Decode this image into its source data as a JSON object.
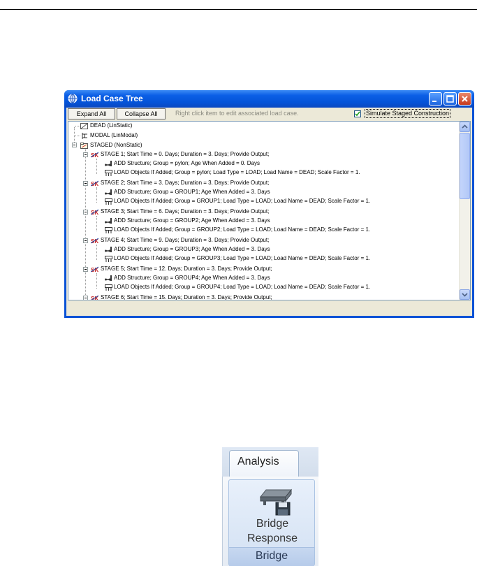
{
  "window": {
    "title": "Load Case Tree",
    "toolbar": {
      "expand_all": "Expand All",
      "collapse_all": "Collapse All",
      "hint": "Right click item to edit associated load case.",
      "simulate_label": "Simulate Staged Construction",
      "simulate_checked": true
    },
    "tree": {
      "dead": "DEAD   (LinStatic)",
      "modal": "MODAL   (LinModal)",
      "staged": "STAGED   (NonStatic)",
      "stages": [
        {
          "label": "STAGE 1;    Start Time = 0. Days;     Duration = 3. Days;     Provide Output;",
          "add": "ADD Structure;    Group = pylon;    Age When Added = 0. Days",
          "load": "LOAD Objects If Added;    Group = pylon;    Load Type = LOAD;    Load Name = DEAD;    Scale Factor = 1."
        },
        {
          "label": "STAGE 2;    Start Time = 3. Days;     Duration = 3. Days;     Provide Output;",
          "add": "ADD Structure;    Group = GROUP1;    Age When Added = 3. Days",
          "load": "LOAD Objects If Added;    Group = GROUP1;    Load Type = LOAD;    Load Name = DEAD;    Scale Factor = 1."
        },
        {
          "label": "STAGE 3;    Start Time = 6. Days;     Duration = 3. Days;     Provide Output;",
          "add": "ADD Structure;    Group = GROUP2;    Age When Added = 3. Days",
          "load": "LOAD Objects If Added;    Group = GROUP2;    Load Type = LOAD;    Load Name = DEAD;    Scale Factor = 1."
        },
        {
          "label": "STAGE 4;    Start Time = 9. Days;     Duration = 3. Days;     Provide Output;",
          "add": "ADD Structure;    Group = GROUP3;    Age When Added = 3. Days",
          "load": "LOAD Objects If Added;    Group = GROUP3;    Load Type = LOAD;    Load Name = DEAD;    Scale Factor = 1."
        },
        {
          "label": "STAGE 5;    Start Time = 12. Days;     Duration = 3. Days;     Provide Output;",
          "add": "ADD Structure;    Group = GROUP4;    Age When Added = 3. Days",
          "load": "LOAD Objects If Added;    Group = GROUP4;    Load Type = LOAD;    Load Name = DEAD;    Scale Factor = 1."
        },
        {
          "label": "STAGE 6;    Start Time = 15. Days;     Duration = 3. Days;     Provide Output;"
        }
      ]
    }
  },
  "ribbon": {
    "tab": "Analysis",
    "button_line1": "Bridge",
    "button_line2": "Response",
    "group": "Bridge"
  },
  "colors": {
    "titlebar": "#0453d8",
    "stage_icon": "#c62828",
    "ribbon_accent": "#b6cbea"
  }
}
